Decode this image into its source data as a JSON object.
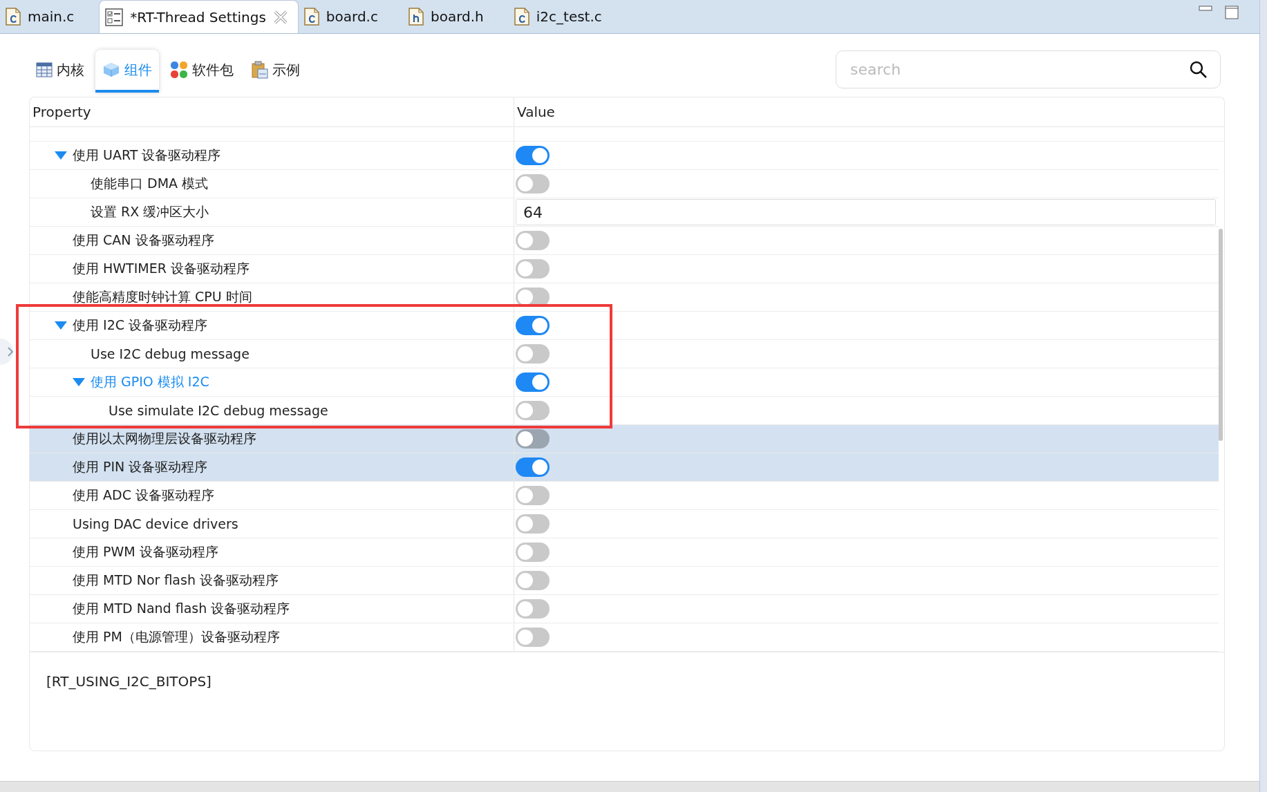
{
  "editor_tabs": [
    {
      "label": "main.c",
      "kind": "c",
      "selected": false,
      "closable": false
    },
    {
      "label": "*RT-Thread Settings",
      "kind": "settings",
      "selected": true,
      "closable": true
    },
    {
      "label": "board.c",
      "kind": "c",
      "selected": false,
      "closable": false
    },
    {
      "label": "board.h",
      "kind": "h",
      "selected": false,
      "closable": false
    },
    {
      "label": "i2c_test.c",
      "kind": "c",
      "selected": false,
      "closable": false
    }
  ],
  "settings_tabs": [
    {
      "label": "内核",
      "kind": "table",
      "selected": false
    },
    {
      "label": "组件",
      "kind": "cube",
      "selected": true
    },
    {
      "label": "软件包",
      "kind": "dots",
      "selected": false
    },
    {
      "label": "示例",
      "kind": "clipboard",
      "selected": false
    }
  ],
  "search": {
    "placeholder": "search"
  },
  "table": {
    "columns": [
      "Property",
      "Value"
    ],
    "rows": [
      {
        "label": "使用 UART 设备驱动程序",
        "kind": "toggle",
        "on": true,
        "expanded": true,
        "selected": false,
        "highlighted": false,
        "children": [
          {
            "label": "使能串口 DMA 模式",
            "kind": "toggle",
            "on": false,
            "selected": false,
            "highlighted": false
          },
          {
            "label": "设置 RX 缓冲区大小",
            "kind": "text",
            "value": "64",
            "selected": false,
            "highlighted": false
          }
        ]
      },
      {
        "label": "使用 CAN 设备驱动程序",
        "kind": "toggle",
        "on": false,
        "selected": false,
        "highlighted": false
      },
      {
        "label": "使用 HWTIMER 设备驱动程序",
        "kind": "toggle",
        "on": false,
        "selected": false,
        "highlighted": false
      },
      {
        "label": "使能高精度时钟计算 CPU 时间",
        "kind": "toggle",
        "on": false,
        "selected": false,
        "highlighted": false
      },
      {
        "label": "使用 I2C 设备驱动程序",
        "kind": "toggle",
        "on": true,
        "expanded": true,
        "selected": false,
        "highlighted": false,
        "children": [
          {
            "label": "Use I2C debug message",
            "kind": "toggle",
            "on": false,
            "selected": false,
            "highlighted": false
          },
          {
            "label": "使用 GPIO 模拟 I2C",
            "kind": "toggle",
            "on": true,
            "expanded": true,
            "selected": true,
            "highlighted": false,
            "children": [
              {
                "label": "Use simulate I2C debug message",
                "kind": "toggle",
                "on": false,
                "selected": false,
                "highlighted": false
              }
            ]
          }
        ]
      },
      {
        "label": "使用以太网物理层设备驱动程序",
        "kind": "toggle",
        "on": false,
        "selected": false,
        "highlighted": true
      },
      {
        "label": "使用 PIN 设备驱动程序",
        "kind": "toggle",
        "on": true,
        "selected": false,
        "highlighted": true
      },
      {
        "label": "使用 ADC 设备驱动程序",
        "kind": "toggle",
        "on": false,
        "selected": false,
        "highlighted": false
      },
      {
        "label": "Using DAC device drivers",
        "kind": "toggle",
        "on": false,
        "selected": false,
        "highlighted": false
      },
      {
        "label": "使用 PWM 设备驱动程序",
        "kind": "toggle",
        "on": false,
        "selected": false,
        "highlighted": false
      },
      {
        "label": "使用 MTD Nor flash 设备驱动程序",
        "kind": "toggle",
        "on": false,
        "selected": false,
        "highlighted": false
      },
      {
        "label": "使用 MTD Nand flash 设备驱动程序",
        "kind": "toggle",
        "on": false,
        "selected": false,
        "highlighted": false
      },
      {
        "label": "使用 PM（电源管理）设备驱动程序",
        "kind": "toggle",
        "on": false,
        "selected": false,
        "highlighted": false
      }
    ]
  },
  "description": "[RT_USING_I2C_BITOPS]"
}
